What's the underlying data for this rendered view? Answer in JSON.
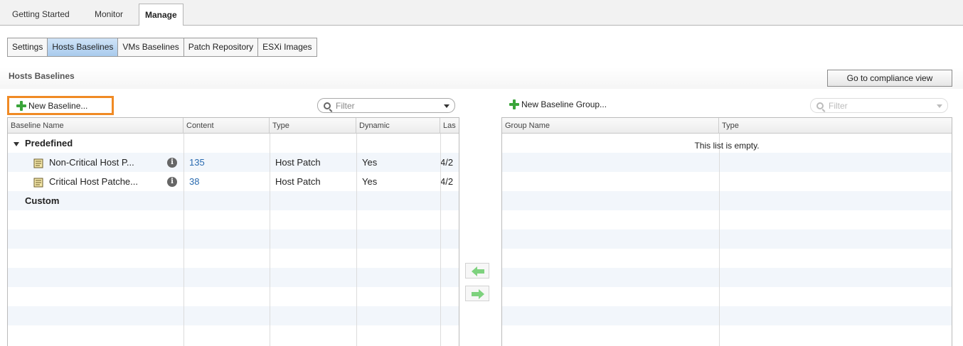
{
  "top_tabs": [
    {
      "label": "Getting Started"
    },
    {
      "label": "Monitor"
    },
    {
      "label": "Manage"
    }
  ],
  "sub_tabs": [
    {
      "label": "Settings"
    },
    {
      "label": "Hosts Baselines"
    },
    {
      "label": "VMs Baselines"
    },
    {
      "label": "Patch Repository"
    },
    {
      "label": "ESXi Images"
    }
  ],
  "section_title": "Hosts Baselines",
  "compliance_button": "Go to compliance view",
  "new_baseline_label": "New Baseline...",
  "new_group_label": "New Baseline Group...",
  "filter_placeholder": "Filter",
  "baselines_table": {
    "columns": [
      "Baseline Name",
      "Content",
      "Type",
      "Dynamic",
      "Las"
    ],
    "group_predefined": "Predefined",
    "group_custom": "Custom",
    "rows": [
      {
        "name": "Non-Critical Host P...",
        "content": "135",
        "type": "Host Patch",
        "dynamic": "Yes",
        "last": "4/2"
      },
      {
        "name": "Critical Host Patche...",
        "content": "38",
        "type": "Host Patch",
        "dynamic": "Yes",
        "last": "4/2"
      }
    ]
  },
  "groups_table": {
    "columns": [
      "Group Name",
      "Type"
    ],
    "empty_message": "This list is empty."
  },
  "colors": {
    "highlight": "#f08a24",
    "active_tab": "#a9cbed",
    "link": "#2a6bb0",
    "arrow": "#7ed27e"
  }
}
